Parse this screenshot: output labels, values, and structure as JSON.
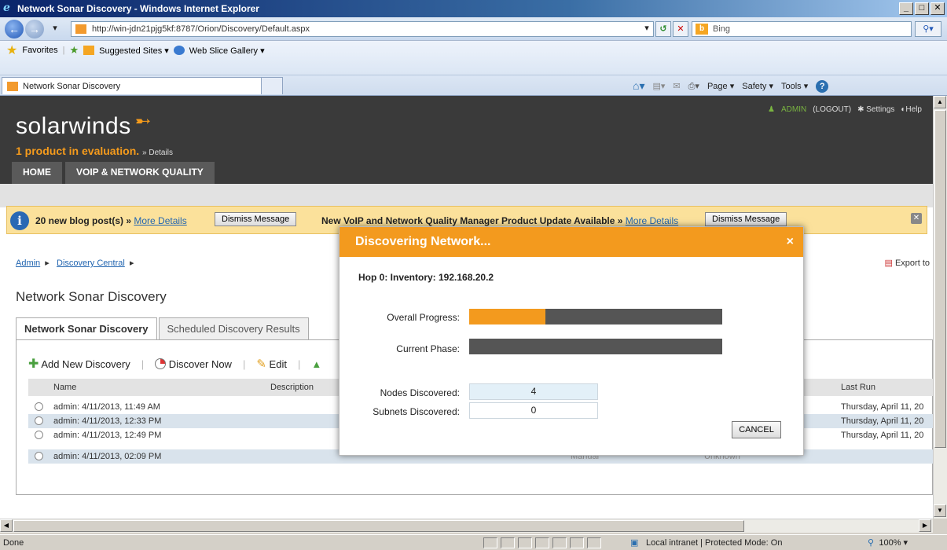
{
  "window": {
    "title": "Network Sonar Discovery - Windows Internet Explorer",
    "min": "_",
    "max": "□",
    "close": "✕"
  },
  "browser": {
    "url": "http://win-jdn21pjg5kf:8787/Orion/Discovery/Default.aspx",
    "search_placeholder": "Bing",
    "favorites_label": "Favorites",
    "suggested_sites": "Suggested Sites ▾",
    "web_slice": "Web Slice Gallery ▾",
    "tab_title": "Network Sonar Discovery",
    "cmd_page": "Page ▾",
    "cmd_safety": "Safety ▾",
    "cmd_tools": "Tools ▾",
    "cmd_help": "?"
  },
  "header": {
    "logo": "solarwinds",
    "eval_text": "1 product in evaluation.",
    "eval_details": "» Details",
    "nav": [
      "HOME",
      "VOIP & NETWORK QUALITY"
    ],
    "admin": "ADMIN",
    "logout": "(LOGOUT)",
    "settings": "✱ Settings",
    "help": "◐Help"
  },
  "banner": {
    "msg1": "20 new blog post(s) »",
    "msg1_more": "More Details",
    "dismiss": "Dismiss Message",
    "msg2": "New VoIP and Network Quality Manager Product Update Available »",
    "msg2_more": "More Details"
  },
  "breadcrumb": [
    "Admin",
    "Discovery Central"
  ],
  "export_label": "Export to",
  "page_title": "Network Sonar Discovery",
  "tabs": [
    "Network Sonar Discovery",
    "Scheduled Discovery Results"
  ],
  "toolbar": {
    "add": "Add New Discovery",
    "discover": "Discover Now",
    "edit": "Edit"
  },
  "grid": {
    "columns": [
      "Name",
      "Description",
      "Last Run"
    ],
    "rows": [
      {
        "name": "admin: 4/11/2013, 11:49 AM",
        "last_run": "Thursday, April 11, 20",
        "type": "",
        "status": ""
      },
      {
        "name": "admin: 4/11/2013, 12:33 PM",
        "last_run": "Thursday, April 11, 20",
        "type": "",
        "status": ""
      },
      {
        "name": "admin: 4/11/2013, 12:49 PM",
        "last_run": "Thursday, April 11, 20",
        "type": "",
        "status": ""
      },
      {
        "name": "admin: 4/11/2013, 02:09 PM",
        "last_run": "",
        "type": "Manual",
        "status": "Unknown"
      }
    ]
  },
  "modal": {
    "title": "Discovering Network...",
    "close": "×",
    "hop": "Hop 0: Inventory: 192.168.20.2",
    "overall_label": "Overall Progress:",
    "overall_progress": 0.3,
    "phase_label": "Current Phase:",
    "phase_progress": 0,
    "nodes_label": "Nodes Discovered:",
    "nodes_value": "4",
    "subnets_label": "Subnets Discovered:",
    "subnets_value": "0",
    "cancel": "CANCEL"
  },
  "status": {
    "done": "Done",
    "zone": "Local intranet | Protected Mode: On",
    "zoom": "      100% ▾"
  }
}
